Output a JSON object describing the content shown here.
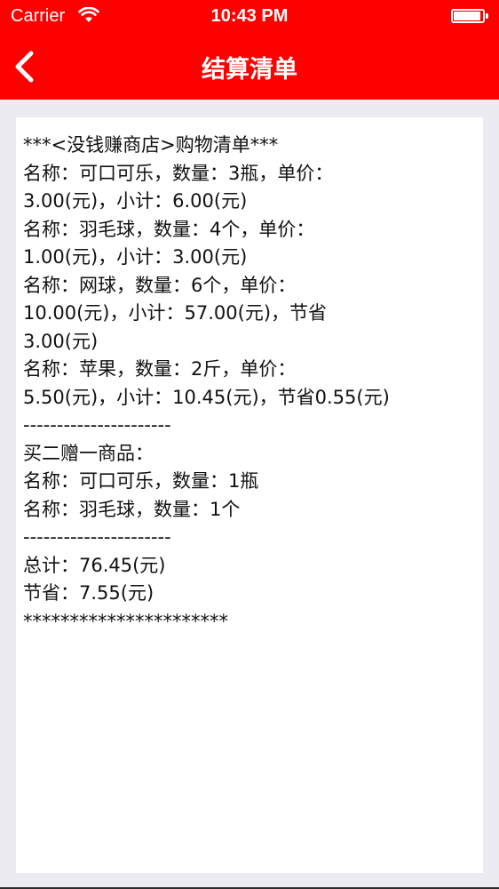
{
  "status_bar": {
    "carrier": "Carrier",
    "time": "10:43 PM",
    "wifi_icon": "wifi-icon",
    "battery_icon": "battery-icon"
  },
  "nav_bar": {
    "title": "结算清单",
    "back_icon": "chevron-left-icon",
    "background": "#fe0000"
  },
  "receipt": {
    "lines": [
      "***<没钱赚商店>购物清单***",
      "名称：可口可乐，数量：3瓶，单价：",
      "3.00(元)，小计：6.00(元)",
      "名称：羽毛球，数量：4个，单价：",
      "1.00(元)，小计：3.00(元)",
      "名称：网球，数量：6个，单价：",
      "10.00(元)，小计：57.00(元)，节省",
      "3.00(元)",
      "名称：苹果，数量：2斤，单价：",
      "5.50(元)，小计：10.45(元)，节省0.55(元)",
      "----------------------",
      "买二赠一商品：",
      "名称：可口可乐，数量：1瓶",
      "名称：羽毛球，数量：1个",
      "----------------------",
      "总计：76.45(元)",
      "节省：7.55(元)",
      "**********************"
    ]
  }
}
